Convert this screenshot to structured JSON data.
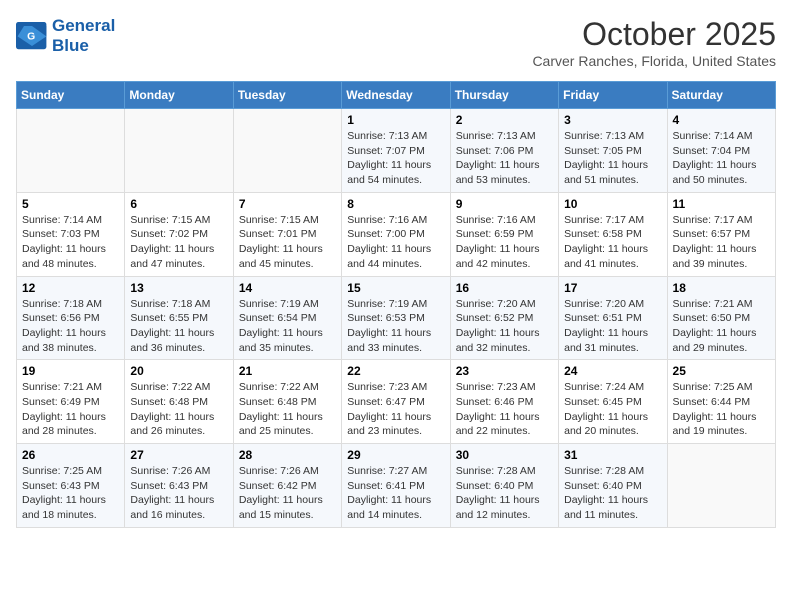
{
  "header": {
    "logo_line1": "General",
    "logo_line2": "Blue",
    "month": "October 2025",
    "location": "Carver Ranches, Florida, United States"
  },
  "weekdays": [
    "Sunday",
    "Monday",
    "Tuesday",
    "Wednesday",
    "Thursday",
    "Friday",
    "Saturday"
  ],
  "weeks": [
    [
      {
        "day": "",
        "content": ""
      },
      {
        "day": "",
        "content": ""
      },
      {
        "day": "",
        "content": ""
      },
      {
        "day": "1",
        "content": "Sunrise: 7:13 AM\nSunset: 7:07 PM\nDaylight: 11 hours and 54 minutes."
      },
      {
        "day": "2",
        "content": "Sunrise: 7:13 AM\nSunset: 7:06 PM\nDaylight: 11 hours and 53 minutes."
      },
      {
        "day": "3",
        "content": "Sunrise: 7:13 AM\nSunset: 7:05 PM\nDaylight: 11 hours and 51 minutes."
      },
      {
        "day": "4",
        "content": "Sunrise: 7:14 AM\nSunset: 7:04 PM\nDaylight: 11 hours and 50 minutes."
      }
    ],
    [
      {
        "day": "5",
        "content": "Sunrise: 7:14 AM\nSunset: 7:03 PM\nDaylight: 11 hours and 48 minutes."
      },
      {
        "day": "6",
        "content": "Sunrise: 7:15 AM\nSunset: 7:02 PM\nDaylight: 11 hours and 47 minutes."
      },
      {
        "day": "7",
        "content": "Sunrise: 7:15 AM\nSunset: 7:01 PM\nDaylight: 11 hours and 45 minutes."
      },
      {
        "day": "8",
        "content": "Sunrise: 7:16 AM\nSunset: 7:00 PM\nDaylight: 11 hours and 44 minutes."
      },
      {
        "day": "9",
        "content": "Sunrise: 7:16 AM\nSunset: 6:59 PM\nDaylight: 11 hours and 42 minutes."
      },
      {
        "day": "10",
        "content": "Sunrise: 7:17 AM\nSunset: 6:58 PM\nDaylight: 11 hours and 41 minutes."
      },
      {
        "day": "11",
        "content": "Sunrise: 7:17 AM\nSunset: 6:57 PM\nDaylight: 11 hours and 39 minutes."
      }
    ],
    [
      {
        "day": "12",
        "content": "Sunrise: 7:18 AM\nSunset: 6:56 PM\nDaylight: 11 hours and 38 minutes."
      },
      {
        "day": "13",
        "content": "Sunrise: 7:18 AM\nSunset: 6:55 PM\nDaylight: 11 hours and 36 minutes."
      },
      {
        "day": "14",
        "content": "Sunrise: 7:19 AM\nSunset: 6:54 PM\nDaylight: 11 hours and 35 minutes."
      },
      {
        "day": "15",
        "content": "Sunrise: 7:19 AM\nSunset: 6:53 PM\nDaylight: 11 hours and 33 minutes."
      },
      {
        "day": "16",
        "content": "Sunrise: 7:20 AM\nSunset: 6:52 PM\nDaylight: 11 hours and 32 minutes."
      },
      {
        "day": "17",
        "content": "Sunrise: 7:20 AM\nSunset: 6:51 PM\nDaylight: 11 hours and 31 minutes."
      },
      {
        "day": "18",
        "content": "Sunrise: 7:21 AM\nSunset: 6:50 PM\nDaylight: 11 hours and 29 minutes."
      }
    ],
    [
      {
        "day": "19",
        "content": "Sunrise: 7:21 AM\nSunset: 6:49 PM\nDaylight: 11 hours and 28 minutes."
      },
      {
        "day": "20",
        "content": "Sunrise: 7:22 AM\nSunset: 6:48 PM\nDaylight: 11 hours and 26 minutes."
      },
      {
        "day": "21",
        "content": "Sunrise: 7:22 AM\nSunset: 6:48 PM\nDaylight: 11 hours and 25 minutes."
      },
      {
        "day": "22",
        "content": "Sunrise: 7:23 AM\nSunset: 6:47 PM\nDaylight: 11 hours and 23 minutes."
      },
      {
        "day": "23",
        "content": "Sunrise: 7:23 AM\nSunset: 6:46 PM\nDaylight: 11 hours and 22 minutes."
      },
      {
        "day": "24",
        "content": "Sunrise: 7:24 AM\nSunset: 6:45 PM\nDaylight: 11 hours and 20 minutes."
      },
      {
        "day": "25",
        "content": "Sunrise: 7:25 AM\nSunset: 6:44 PM\nDaylight: 11 hours and 19 minutes."
      }
    ],
    [
      {
        "day": "26",
        "content": "Sunrise: 7:25 AM\nSunset: 6:43 PM\nDaylight: 11 hours and 18 minutes."
      },
      {
        "day": "27",
        "content": "Sunrise: 7:26 AM\nSunset: 6:43 PM\nDaylight: 11 hours and 16 minutes."
      },
      {
        "day": "28",
        "content": "Sunrise: 7:26 AM\nSunset: 6:42 PM\nDaylight: 11 hours and 15 minutes."
      },
      {
        "day": "29",
        "content": "Sunrise: 7:27 AM\nSunset: 6:41 PM\nDaylight: 11 hours and 14 minutes."
      },
      {
        "day": "30",
        "content": "Sunrise: 7:28 AM\nSunset: 6:40 PM\nDaylight: 11 hours and 12 minutes."
      },
      {
        "day": "31",
        "content": "Sunrise: 7:28 AM\nSunset: 6:40 PM\nDaylight: 11 hours and 11 minutes."
      },
      {
        "day": "",
        "content": ""
      }
    ]
  ]
}
